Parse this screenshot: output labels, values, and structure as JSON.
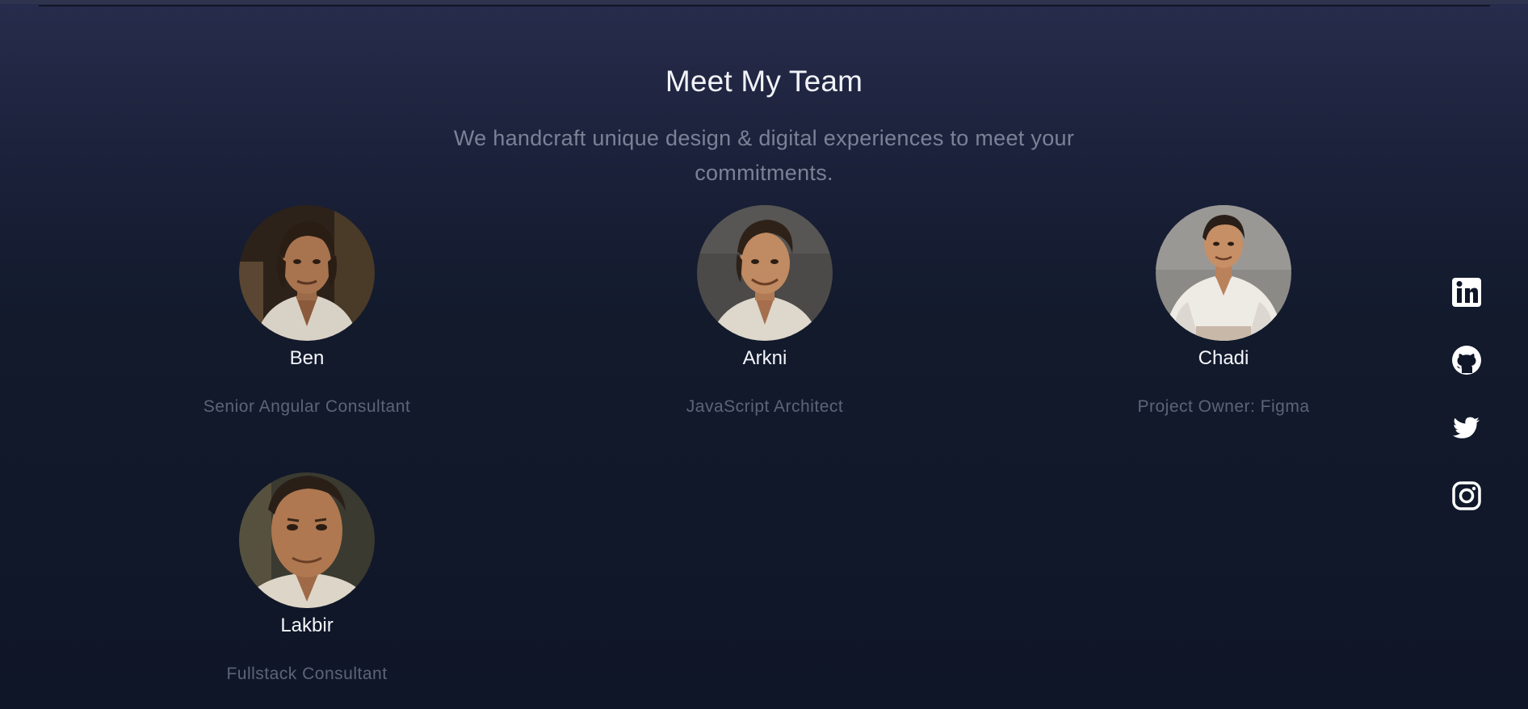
{
  "section": {
    "title": "Meet My Team",
    "subtitle": "We handcraft unique design & digital experiences to meet your commitments."
  },
  "team": [
    {
      "name": "Ben",
      "role": "Senior Angular Consultant"
    },
    {
      "name": "Arkni",
      "role": "JavaScript Architect"
    },
    {
      "name": "Chadi",
      "role": "Project Owner: Figma"
    },
    {
      "name": "Lakbir",
      "role": "Fullstack Consultant"
    }
  ],
  "social": [
    {
      "icon": "linkedin-icon"
    },
    {
      "icon": "github-icon"
    },
    {
      "icon": "twitter-icon"
    },
    {
      "icon": "instagram-icon"
    }
  ],
  "colors": {
    "background_top": "#272c4c",
    "background_bottom": "#0f1627",
    "title": "#f2f3f8",
    "subtitle": "#7b8296",
    "role": "#5c6478",
    "icon": "#ffffff"
  }
}
